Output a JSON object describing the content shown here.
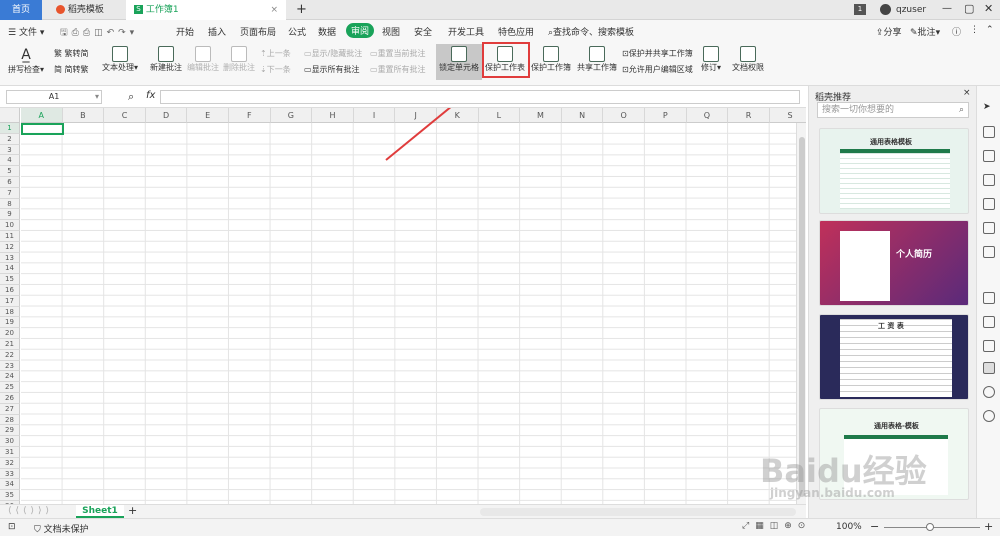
{
  "titlebar": {
    "tab_home": "首页",
    "tab_docer": "稻壳模板",
    "tab_workbook": "工作簿1",
    "new_tab": "+",
    "badge": "1",
    "user": "qzuser"
  },
  "menubar": {
    "file": "文件",
    "items": [
      "开始",
      "插入",
      "页面布局",
      "公式",
      "数据",
      "审阅",
      "视图",
      "安全",
      "开发工具",
      "特色应用"
    ],
    "active": "审阅",
    "search": "查找命令、搜索模板",
    "share": "分享",
    "comment": "批注"
  },
  "ribbon": {
    "spell_check": "拼写检查",
    "trad_to_simp": "繁转简",
    "simp_to_trad": "简转繁",
    "text_process": "文本处理",
    "new_comment": "新建批注",
    "edit_comment": "编辑批注",
    "delete_comment": "删除批注",
    "prev": "上一条",
    "next": "下一条",
    "show_hide_comment": "显示/隐藏批注",
    "show_all_comments": "显示所有批注",
    "reset_current_comment": "重置当前批注",
    "reset_all_comments": "重置所有批注",
    "lock_cell": "锁定单元格",
    "protect_sheet": "保护工作表",
    "protect_workbook": "保护工作簿",
    "share_workbook": "共享工作簿",
    "protect_shared_workbook": "保护并共享工作簿",
    "allow_edit_ranges": "允许用户编辑区域",
    "revise": "修订",
    "doc_rights": "文档权限"
  },
  "formula": {
    "cell_ref": "A1",
    "fx": "fx",
    "value": ""
  },
  "grid": {
    "columns": [
      "A",
      "B",
      "C",
      "D",
      "E",
      "F",
      "G",
      "H",
      "I",
      "J",
      "K",
      "L",
      "M",
      "N",
      "O",
      "P",
      "Q",
      "R",
      "S"
    ],
    "rows": [
      "1",
      "2",
      "3",
      "4",
      "5",
      "6",
      "7",
      "8",
      "9",
      "10",
      "11",
      "12",
      "13",
      "14",
      "15",
      "16",
      "17",
      "18",
      "19",
      "20",
      "21",
      "22",
      "23",
      "24",
      "25",
      "26",
      "27",
      "28",
      "29",
      "30",
      "31",
      "32",
      "33",
      "34",
      "35",
      "36"
    ]
  },
  "sheetbar": {
    "sheet": "Sheet1",
    "add": "+"
  },
  "statusbar": {
    "protect": "文档未保护",
    "zoom": "100%"
  },
  "panel": {
    "title": "稻壳推荐",
    "search_placeholder": "搜索一切你想要的",
    "card1": "通用表格模板",
    "card2": "个人简历",
    "card3": "工 资 表",
    "card4": "通用表格-模板"
  },
  "watermark": {
    "logo": "Baidu经验",
    "url": "jingyan.baidu.com"
  },
  "colors": {
    "accent": "#1aa35a",
    "highlight": "#e03c3c",
    "tab_active": "#ffffff"
  }
}
